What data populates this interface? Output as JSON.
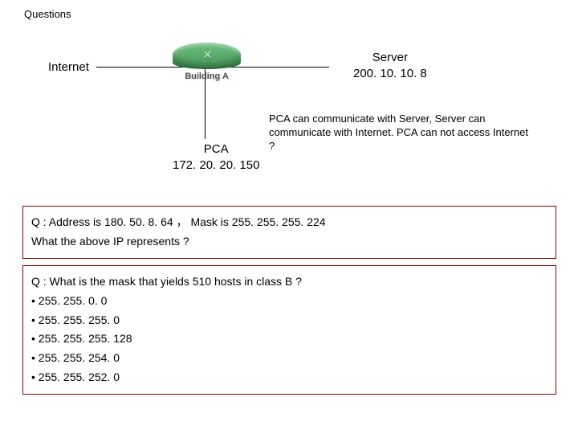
{
  "title": "Questions",
  "diagram": {
    "internet_label": "Internet",
    "router_label": "Building A",
    "router_arrows": "✕",
    "server": {
      "name": "Server",
      "ip": "200. 10. 10. 8"
    },
    "pca": {
      "name": "PCA",
      "ip": "172. 20. 20. 150"
    },
    "scenario": "PCA can communicate with Server, Server can communicate with Internet. PCA can not access Internet ?"
  },
  "q1": {
    "line1": "Q : Address is  180. 50. 8. 64 ， Mask is  255. 255. 255. 224",
    "line2": "What the above IP represents ?"
  },
  "q2": {
    "prompt": "Q : What is the mask that yields 510 hosts in class B ?",
    "options": [
      "• 255. 255. 0. 0",
      "• 255. 255. 255. 0",
      "• 255. 255. 255. 128",
      "• 255. 255. 254. 0",
      "• 255. 255. 252. 0"
    ]
  }
}
